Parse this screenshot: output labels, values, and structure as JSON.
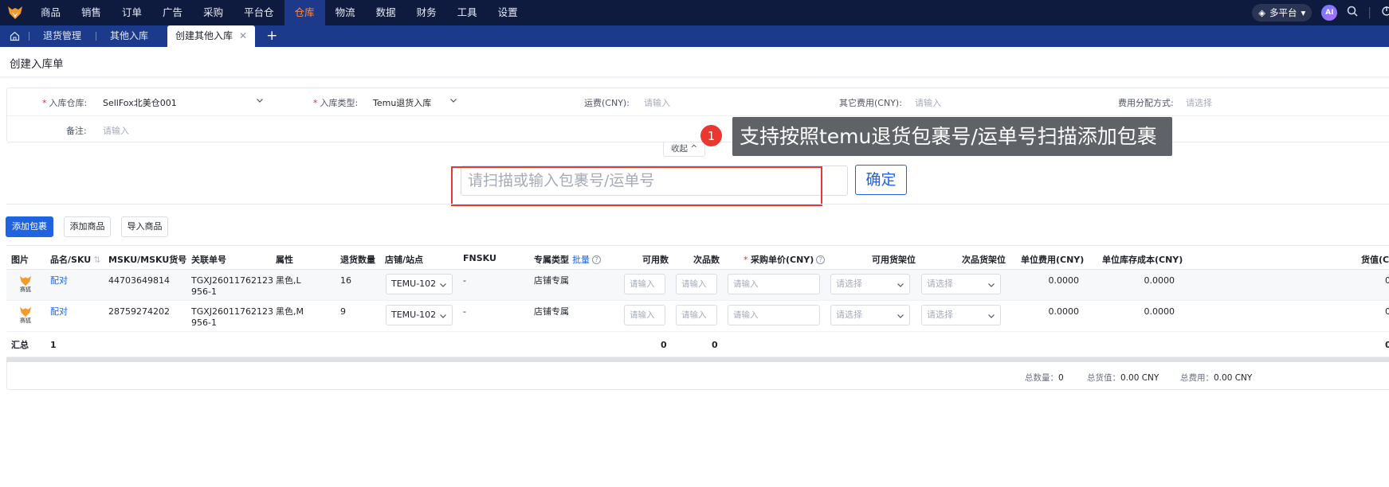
{
  "nav": {
    "items": [
      "商品",
      "销售",
      "订单",
      "广告",
      "采购",
      "平台仓",
      "仓库",
      "物流",
      "数据",
      "财务",
      "工具",
      "设置"
    ],
    "active_index": 6,
    "platform_label": "多平台",
    "ai_label": "AI"
  },
  "tabs": {
    "items": [
      "退货管理",
      "其他入库"
    ],
    "active_label": "创建其他入库",
    "close_glyph": "✕",
    "add_glyph": "+"
  },
  "page": {
    "title": "创建入库单"
  },
  "form": {
    "warehouse_label": "入库仓库:",
    "warehouse_value": "SellFox北美仓001",
    "type_label": "入库类型:",
    "type_value": "Temu退货入库",
    "freight_label": "运费(CNY):",
    "freight_placeholder": "请输入",
    "other_fee_label": "其它费用(CNY):",
    "other_fee_placeholder": "请输入",
    "alloc_label": "费用分配方式:",
    "alloc_placeholder": "请选择",
    "remark_label": "备注:",
    "remark_placeholder": "请输入",
    "collapse_label": "收起 ^"
  },
  "annotation": {
    "number": "1",
    "text": "支持按照temu退货包裹号/运单号扫描添加包裹"
  },
  "scan": {
    "placeholder": "请扫描或输入包裹号/运单号",
    "confirm_label": "确定"
  },
  "actions": {
    "add_package": "添加包裹",
    "add_product": "添加商品",
    "import_product": "导入商品"
  },
  "table": {
    "headers": {
      "image": "图片",
      "name_sku": "品名/SKU",
      "msku": "MSKU/MSKU货号",
      "related_no": "关联单号",
      "attr": "属性",
      "return_qty": "退货数量",
      "store_site": "店铺/站点",
      "fnsku": "FNSKU",
      "exclusive_type": "专属类型",
      "batch": "批量",
      "available": "可用数",
      "defective": "次品数",
      "purchase_price": "采购单价(CNY)",
      "avail_shelf": "可用货架位",
      "def_shelf": "次品货架位",
      "unit_fee": "单位费用(CNY)",
      "unit_cost": "单位库存成本(CNY)",
      "goods_value": "货值(C"
    },
    "rows": [
      {
        "thumb_caption": "赛狐",
        "match": "配对",
        "msku": "44703649814",
        "related_1": "TGXJ26011762123",
        "related_2": "956-1",
        "attr": "黑色,L",
        "qty": "16",
        "store": "TEMU-102",
        "fnsku": "-",
        "exclusive": "店铺专属",
        "available_ph": "请输入",
        "defective_ph": "请输入",
        "price_ph": "请输入",
        "avail_shelf_ph": "请选择",
        "def_shelf_ph": "请选择",
        "unit_fee": "0.0000",
        "unit_cost": "0.0000",
        "goods_value": "0"
      },
      {
        "thumb_caption": "赛狐",
        "match": "配对",
        "msku": "28759274202",
        "related_1": "TGXJ26011762123",
        "related_2": "956-1",
        "attr": "黑色,M",
        "qty": "9",
        "store": "TEMU-102",
        "fnsku": "-",
        "exclusive": "店铺专属",
        "available_ph": "请输入",
        "defective_ph": "请输入",
        "price_ph": "请输入",
        "avail_shelf_ph": "请选择",
        "def_shelf_ph": "请选择",
        "unit_fee": "0.0000",
        "unit_cost": "0.0000",
        "goods_value": "0"
      }
    ],
    "summary": {
      "label": "汇总",
      "count": "1",
      "available_total": "0",
      "defective_total": "0",
      "goods_value_total": "0"
    }
  },
  "footer": {
    "total_qty_label": "总数量：",
    "total_qty": "0",
    "total_value_label": "总货值：",
    "total_value": "0.00 CNY",
    "total_fee_label": "总费用：",
    "total_fee": "0.00 CNY"
  },
  "colors": {
    "nav_bg": "#0e1b3f",
    "tab_bg": "#1b3a8c",
    "accent": "#1f63e0",
    "active_nav_text": "#ff8a3d",
    "required": "#f5222d"
  }
}
